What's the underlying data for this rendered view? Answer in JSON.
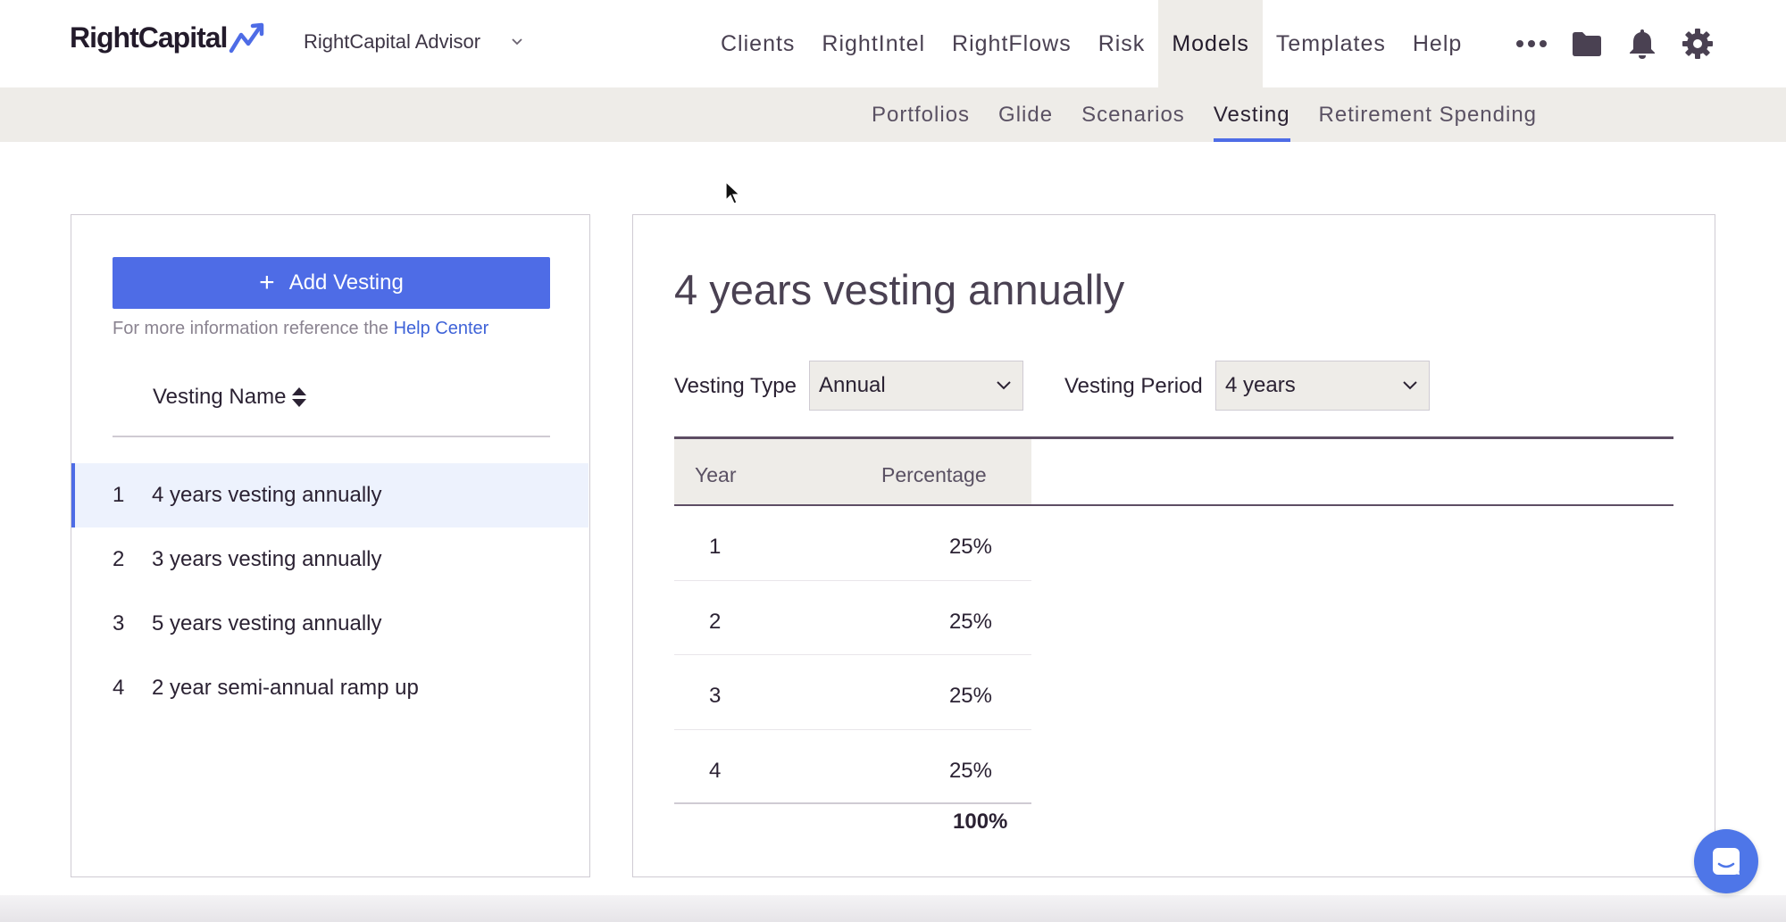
{
  "header": {
    "logo_text": "RightCapital",
    "account_selector": "RightCapital Advisor",
    "nav": [
      {
        "label": "Clients"
      },
      {
        "label": "RightIntel"
      },
      {
        "label": "RightFlows"
      },
      {
        "label": "Risk"
      },
      {
        "label": "Models",
        "active": true
      },
      {
        "label": "Templates"
      },
      {
        "label": "Help"
      }
    ],
    "icons": [
      "more-icon",
      "folder-icon",
      "bell-icon",
      "gear-icon"
    ]
  },
  "subnav": {
    "items": [
      {
        "label": "Portfolios"
      },
      {
        "label": "Glide"
      },
      {
        "label": "Scenarios"
      },
      {
        "label": "Vesting",
        "active": true
      },
      {
        "label": "Retirement Spending"
      }
    ]
  },
  "left_panel": {
    "add_button_label": "Add Vesting",
    "help_text": "For more information reference the",
    "help_link": "Help Center",
    "column_header": "Vesting Name",
    "items": [
      {
        "num": "1",
        "name": "4 years vesting annually",
        "selected": true
      },
      {
        "num": "2",
        "name": "3 years vesting annually"
      },
      {
        "num": "3",
        "name": "5 years vesting annually"
      },
      {
        "num": "4",
        "name": "2 year semi-annual ramp up"
      }
    ]
  },
  "detail": {
    "title": "4 years vesting annually",
    "vesting_type_label": "Vesting Type",
    "vesting_type_value": "Annual",
    "vesting_period_label": "Vesting Period",
    "vesting_period_value": "4 years",
    "table": {
      "headers": [
        "Year",
        "Percentage"
      ],
      "rows": [
        {
          "year": "1",
          "percentage": "25%"
        },
        {
          "year": "2",
          "percentage": "25%"
        },
        {
          "year": "3",
          "percentage": "25%"
        },
        {
          "year": "4",
          "percentage": "25%"
        }
      ],
      "total": "100%"
    }
  },
  "colors": {
    "accent": "#4e6ce6",
    "subnav_bg": "#eeece8",
    "selected_row_bg": "#edf2fd",
    "chat_button": "#4e76e8"
  }
}
